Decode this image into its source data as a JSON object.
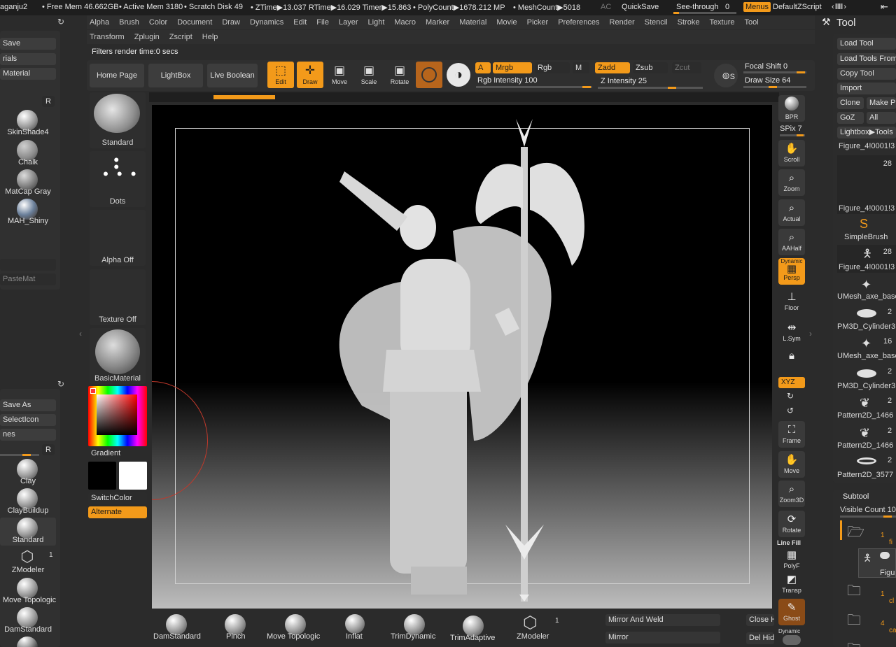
{
  "status": {
    "user": "aganju2",
    "free_mem": "• Free Mem 46.662GB",
    "active_mem": "• Active Mem 3180",
    "scratch": "• Scratch Disk 49",
    "ztime": "• ZTime▶13.037 RTime▶16.029 Timer▶15.863",
    "polycount": "• PolyCount▶1678.212 MP",
    "meshcount": "• MeshCount▶5018",
    "ac": "AC",
    "quicksave": "QuickSave",
    "seethrough": "See-through",
    "seethrough_value": "0",
    "menus": "Menus",
    "script": "DefaultZScript"
  },
  "menu_row1": [
    "Alpha",
    "Brush",
    "Color",
    "Document",
    "Draw",
    "Dynamics",
    "Edit",
    "File",
    "Layer",
    "Light",
    "Macro",
    "Marker",
    "Material",
    "Movie",
    "Picker",
    "Preferences",
    "Render",
    "Stencil",
    "Stroke",
    "Texture",
    "Tool"
  ],
  "menu_row2": [
    "Transform",
    "Zplugin",
    "Zscript",
    "Help"
  ],
  "tool_title": "Tool",
  "filters_text": "Filters render time:0 secs",
  "top_shelf": {
    "home": "Home Page",
    "lightbox": "LightBox",
    "liveboolean": "Live Boolean",
    "edit": "Edit",
    "draw": "Draw",
    "move": "Move",
    "scale": "Scale",
    "rotate": "Rotate",
    "a": "A",
    "mrgb": "Mrgb",
    "rgb": "Rgb",
    "m": "M",
    "rgb_intensity": "Rgb Intensity 100",
    "zadd": "Zadd",
    "zsub": "Zsub",
    "zcut": "Zcut",
    "z_intensity": "Z Intensity 25",
    "focal_shift": "Focal Shift 0",
    "draw_size": "Draw Size 64",
    "s": "S"
  },
  "left_panel": {
    "save": "Save",
    "materials": "rials",
    "material": "Material",
    "r": "R",
    "mats": [
      "SkinShade4",
      "Chalk",
      "MatCap Gray",
      "MAH_Shiny"
    ],
    "pastemat": "PasteMat",
    "saveas": "Save As",
    "selecticon": "SelectIcon",
    "nes": "nes",
    "r2": "R",
    "brushes": [
      "Clay",
      "ClayBuildup",
      "Standard",
      "ZModeler",
      "Move Topologic",
      "DamStandard"
    ],
    "zmodeler_count": "1"
  },
  "left_shelf": {
    "standard": "Standard",
    "dots": "Dots",
    "alpha_off": "Alpha Off",
    "texture_off": "Texture Off",
    "basic_material": "BasicMaterial",
    "gradient": "Gradient",
    "switchcolor": "SwitchColor",
    "alternate": "Alternate"
  },
  "right_shelf": [
    "BPR",
    "SPix 7",
    "Scroll",
    "Zoom",
    "Actual",
    "AAHalf",
    "Persp",
    "Floor",
    "L.Sym",
    "XYZ",
    "Frame",
    "Move",
    "Zoom3D",
    "Rotate",
    "PolyF",
    "Transp",
    "Ghost"
  ],
  "right_shelf_extra": {
    "dynamic": "Dynamic",
    "linefill": "Line Fill",
    "dynamic2": "Dynamic"
  },
  "tool_panel": {
    "load_tool": "Load Tool",
    "load_tools_from": "Load Tools From",
    "copy_tool": "Copy Tool",
    "import": "Import",
    "clone": "Clone",
    "make_p": "Make P",
    "goz": "GoZ",
    "all": "All",
    "lightbox_tools": "Lightbox▶Tools",
    "current_tool": "Figure_4!0001!3",
    "tool_count": "28",
    "tools": [
      {
        "name": "Figure_4!0001!3",
        "count": ""
      },
      {
        "name": "SimpleBrush",
        "count": ""
      },
      {
        "name": "Figure_4!0001!3",
        "count": "28"
      },
      {
        "name": "UMesh_axe_base",
        "count": ""
      },
      {
        "name": "PM3D_Cylinder3",
        "count": "2"
      },
      {
        "name": "UMesh_axe_base",
        "count": "16"
      },
      {
        "name": "PM3D_Cylinder3",
        "count": "2"
      },
      {
        "name": "Pattern2D_1466",
        "count": "2"
      },
      {
        "name": "Pattern2D_1466",
        "count": "2"
      },
      {
        "name": "Pattern2D_3577",
        "count": "2"
      }
    ],
    "subtool": "Subtool",
    "visible_count": "Visible Count 10",
    "sub_items": [
      {
        "num": "1",
        "name": "fi"
      },
      {
        "num": "",
        "name": "Figu"
      },
      {
        "num": "1",
        "name": "cl"
      },
      {
        "num": "4",
        "name": "ca"
      }
    ]
  },
  "bottom_shelf": {
    "brushes": [
      "DamStandard",
      "Pinch",
      "Move Topologic",
      "Inflat",
      "TrimDynamic",
      "TrimAdaptive",
      "ZModeler"
    ],
    "zmodeler_count": "1",
    "mirror_weld": "Mirror And Weld",
    "mirror": "Mirror",
    "close_h": "Close H",
    "del_hid": "Del Hid"
  }
}
